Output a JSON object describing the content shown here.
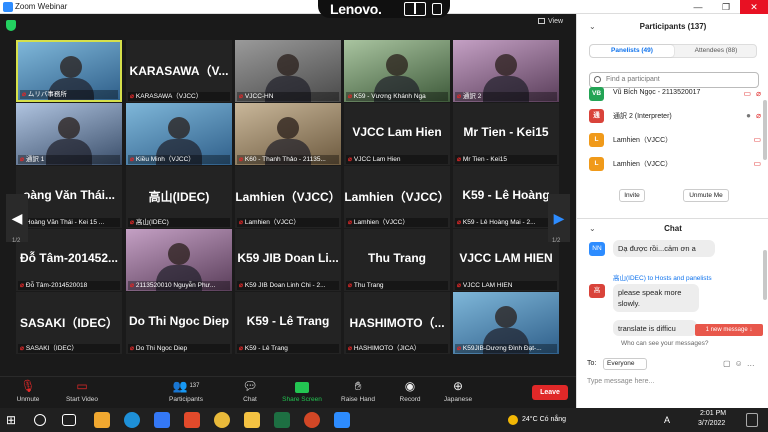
{
  "window": {
    "title": "Zoom Webinar",
    "minimize": "—",
    "maximize": "❐",
    "close": "✕"
  },
  "lenovo": {
    "brand": "Lenovo."
  },
  "view": {
    "label": "View"
  },
  "tiles": [
    {
      "name": "",
      "label": "ムリバ事務所",
      "active": true,
      "video": true
    },
    {
      "name": "KARASAWA（V...",
      "label": "KARASAWA（VJCC）",
      "video": false
    },
    {
      "name": "",
      "label": "VJCC-HN",
      "video": true
    },
    {
      "name": "",
      "label": "K59 - Vương Khánh Nga",
      "video": true
    },
    {
      "name": "",
      "label": "通訳 2",
      "video": true
    },
    {
      "name": "",
      "label": "通訳 1",
      "video": true
    },
    {
      "name": "",
      "label": "Kiều Minh（VJCC）",
      "video": true
    },
    {
      "name": "",
      "label": "K60 - Thanh Thảo - 21135...",
      "video": true
    },
    {
      "name": "VJCC Lam Hien",
      "label": "VJCC Lam Hien",
      "video": false
    },
    {
      "name": "Mr Tien - Kei15",
      "label": "Mr Tien - Kei15",
      "video": false
    },
    {
      "name": "oàng Văn Thái...",
      "label": "Hoàng Văn Thái - Kei 15 ...",
      "video": false
    },
    {
      "name": "高山(IDEC)",
      "label": "高山(IDEC)",
      "video": false
    },
    {
      "name": "Lamhien（VJCC）",
      "label": "Lamhien（VJCC）",
      "video": false
    },
    {
      "name": "Lamhien（VJCC）",
      "label": "Lamhien（VJCC）",
      "video": false
    },
    {
      "name": "K59 - Lê Hoàng",
      "label": "K59 - Lê Hoàng Mai - 2...",
      "video": false
    },
    {
      "name": "Đỗ Tâm-201452...",
      "label": "Đỗ Tâm-2014520018",
      "video": false
    },
    {
      "name": "",
      "label": "2113520010 Nguyễn Phư...",
      "video": true
    },
    {
      "name": "K59 JIB Doan Li...",
      "label": "K59 JIB Doan Linh Chi - 2...",
      "video": false
    },
    {
      "name": "Thu Trang",
      "label": "Thu Trang",
      "video": false
    },
    {
      "name": "VJCC LAM HIEN",
      "label": "VJCC LAM HIEN",
      "video": false
    },
    {
      "name": "SASAKI（IDEC）",
      "label": "SASAKI（IDEC）",
      "video": false
    },
    {
      "name": "Do Thi Ngoc Diep",
      "label": "Do Thi Ngoc Diep",
      "video": false
    },
    {
      "name": "K59 - Lê Trang",
      "label": "K59 - Lê Trang",
      "video": false
    },
    {
      "name": "HASHIMOTO（...",
      "label": "HASHIMOTO（JICA）",
      "video": false
    },
    {
      "name": "",
      "label": "K59JIB-Dương Đình Đạt-...",
      "video": true
    }
  ],
  "pager": {
    "left": "1/2",
    "right": "1/2"
  },
  "toolbar": {
    "unmute": "Unmute",
    "start_video": "Start Video",
    "participants": "Participants",
    "participants_count": "137",
    "chat": "Chat",
    "share_screen": "Share Screen",
    "raise_hand": "Raise Hand",
    "record": "Record",
    "japanese": "Japanese",
    "leave": "Leave"
  },
  "participants": {
    "title": "Participants (137)",
    "tab_panelists": "Panelists (49)",
    "tab_attendees": "Attendees (88)",
    "search_placeholder": "Find a participant",
    "rows": [
      {
        "initials": "VB",
        "name": "Vũ Bích Ngọc - 2113520017",
        "color": "#23a455"
      },
      {
        "initials": "通",
        "name": "通訳 2 (Interpreter)",
        "color": "#d9433a"
      },
      {
        "initials": "L",
        "name": "Lamhien（VJCC）",
        "color": "#f09a1a"
      },
      {
        "initials": "L",
        "name": "Lamhien（VJCC）",
        "color": "#f09a1a"
      }
    ],
    "invite": "Invite",
    "unmute_me": "Unmute Me"
  },
  "chat": {
    "title": "Chat",
    "msg1_avatar": "NN",
    "msg1_text": "Dạ được rồi...cảm ơn a",
    "msg2_from": "高山(IDEC) to Hosts and panelists",
    "msg2_avatar": "高",
    "msg2_text1": "please speak more slowly.",
    "msg2_text2": "translate is difficu",
    "new_message": "1 new message ↓",
    "who_can_see": "Who can see your messages?",
    "to_label": "To:",
    "to_value": "Everyone",
    "input_placeholder": "Type message here..."
  },
  "taskbar": {
    "weather": "24°C Có nắng",
    "lang": "A",
    "time": "2:01 PM",
    "date": "3/7/2022"
  }
}
